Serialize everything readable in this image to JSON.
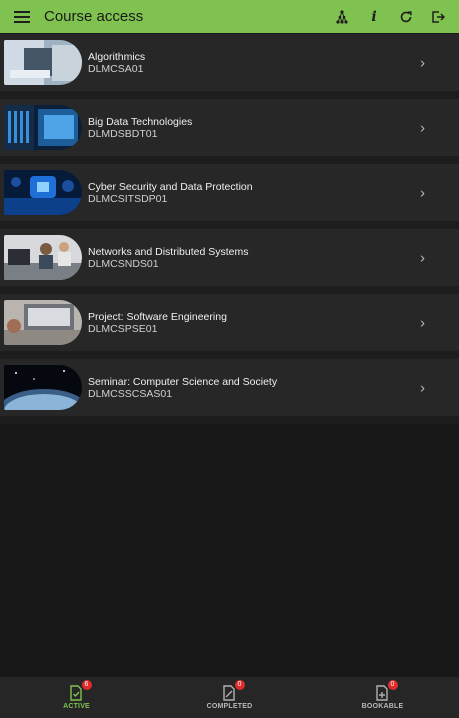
{
  "header": {
    "title": "Course access",
    "icons": [
      "menu-icon",
      "network-icon",
      "info-icon",
      "refresh-icon",
      "logout-icon"
    ],
    "info_glyph": "i"
  },
  "courses": [
    {
      "title": "Algorithmics",
      "code": "DLMCSA01"
    },
    {
      "title": "Big Data Technologies",
      "code": "DLMDSBDT01"
    },
    {
      "title": "Cyber Security and Data Protection",
      "code": "DLMCSITSDP01"
    },
    {
      "title": "Networks and Distributed Systems",
      "code": "DLMCSNDS01"
    },
    {
      "title": "Project: Software Engineering",
      "code": "DLMCSPSE01"
    },
    {
      "title": "Seminar: Computer Science and Society",
      "code": "DLMCSSCSAS01"
    }
  ],
  "tabs": [
    {
      "label": "ACTIVE",
      "badge": "6"
    },
    {
      "label": "COMPLETED",
      "badge": "0"
    },
    {
      "label": "BOOKABLE",
      "badge": "0"
    }
  ],
  "colors": {
    "accent": "#7fc24f",
    "badge": "#e02b2b",
    "background": "#181818",
    "card": "#272727"
  }
}
